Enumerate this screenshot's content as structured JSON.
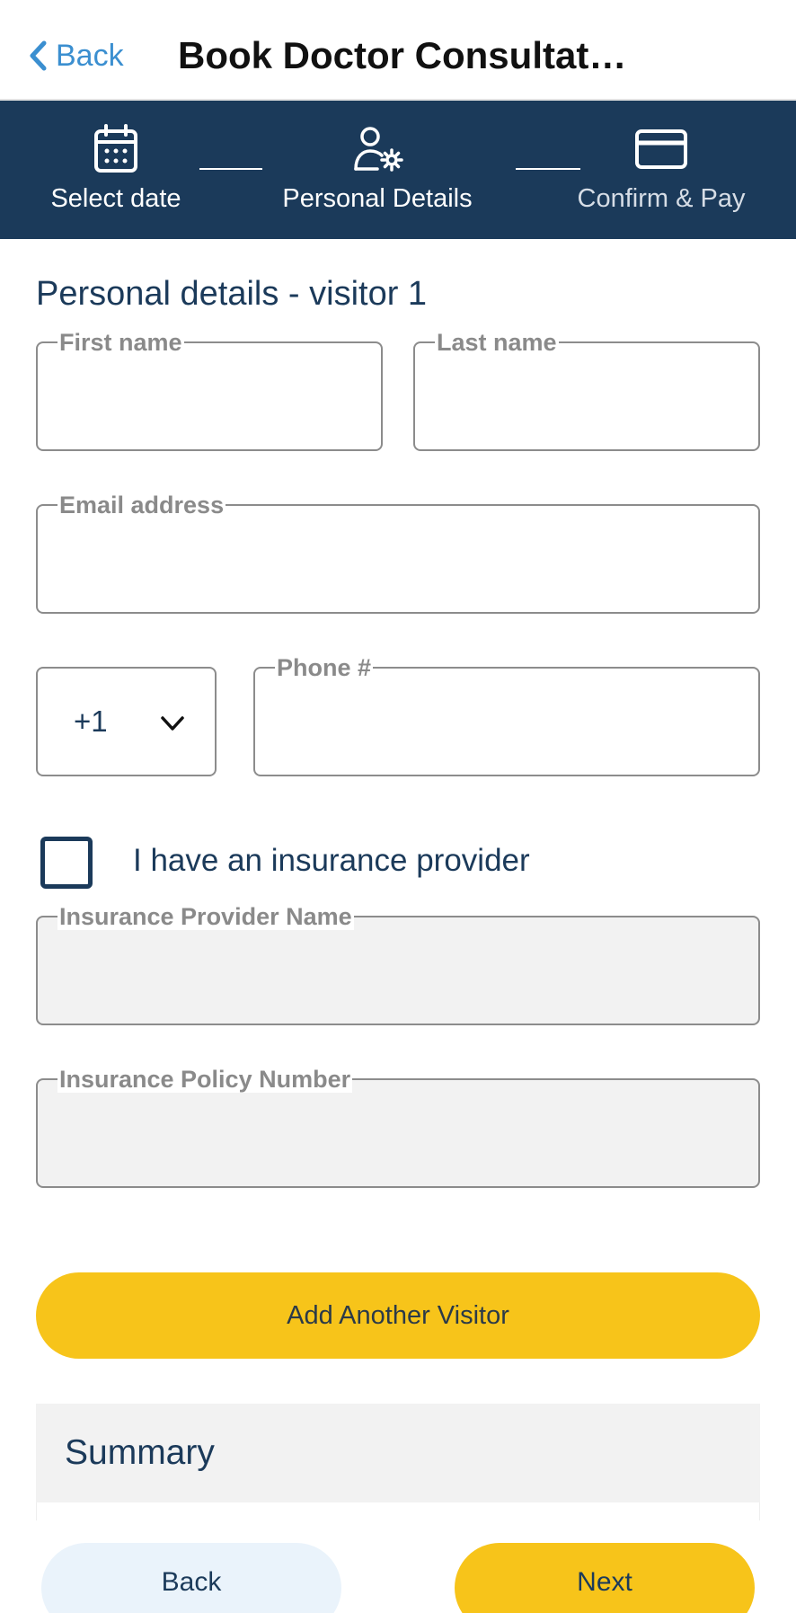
{
  "header": {
    "back_label": "Back",
    "title": "Book Doctor Consultat…"
  },
  "stepper": {
    "steps": [
      {
        "label": "Select date",
        "icon": "calendar-icon",
        "state": "complete"
      },
      {
        "label": "Personal Details",
        "icon": "user-settings-icon",
        "state": "current"
      },
      {
        "label": "Confirm & Pay",
        "icon": "credit-card-icon",
        "state": "upcoming"
      }
    ]
  },
  "form": {
    "section_title": "Personal details - visitor 1",
    "first_name": {
      "label": "First name",
      "value": ""
    },
    "last_name": {
      "label": "Last name",
      "value": ""
    },
    "email": {
      "label": "Email address",
      "value": ""
    },
    "country_code": {
      "value": "+1"
    },
    "phone": {
      "label": "Phone #",
      "value": ""
    },
    "insurance_checkbox": {
      "label": "I have an insurance provider",
      "checked": false
    },
    "insurance_name": {
      "label": "Insurance Provider Name",
      "value": "",
      "disabled": true
    },
    "insurance_policy": {
      "label": "Insurance Policy Number",
      "value": "",
      "disabled": true
    }
  },
  "buttons": {
    "add_visitor": "Add Another Visitor",
    "back": "Back",
    "next": "Next"
  },
  "summary": {
    "title": "Summary"
  },
  "colors": {
    "primary": "#1b3a5a",
    "accent": "#f7c41a",
    "link": "#3b8fd0",
    "disabled_bg": "#f2f2f2"
  }
}
